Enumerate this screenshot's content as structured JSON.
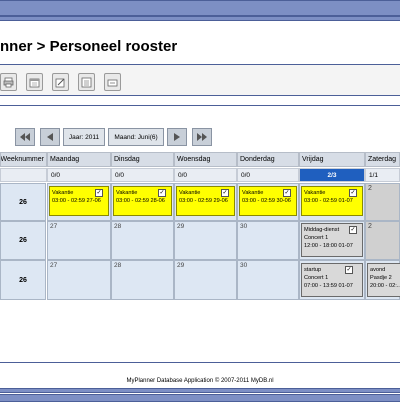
{
  "page": {
    "title": "nner > Personeel rooster"
  },
  "toolbar": {
    "icons": [
      "print-icon",
      "calendar-icon",
      "edit-icon",
      "list-icon",
      "export-icon"
    ]
  },
  "nav": {
    "year": "Jaar: 2011",
    "month": "Maand: Juni(6)"
  },
  "table": {
    "week_header": "Weeknummer",
    "days": [
      {
        "name": "Maandag",
        "count": "0/0"
      },
      {
        "name": "Dinsdag",
        "count": "0/0"
      },
      {
        "name": "Woensdag",
        "count": "0/0"
      },
      {
        "name": "Donderdag",
        "count": "0/0"
      },
      {
        "name": "Vrijdag",
        "count": "2/3"
      },
      {
        "name": "Zaterdag",
        "count": "1/1"
      }
    ],
    "rows": [
      {
        "week": "26",
        "cells": [
          {
            "events": [
              {
                "title": "Vakantie",
                "line1": "03:00 - 02:59 27-06",
                "color": "#ffff00"
              }
            ]
          },
          {
            "events": [
              {
                "title": "Vakantie",
                "line1": "03:00 - 02:59 28-06",
                "color": "#ffff00"
              }
            ]
          },
          {
            "events": [
              {
                "title": "Vakantie",
                "line1": "03:00 - 02:59 29-06",
                "color": "#ffff00"
              }
            ]
          },
          {
            "events": [
              {
                "title": "Vakantie",
                "line1": "03:00 - 02:59 30-06",
                "color": "#ffff00"
              }
            ]
          },
          {
            "events": [
              {
                "title": "Vakantie",
                "line1": "03:00 - 02:59 01-07",
                "color": "#ffff00"
              }
            ]
          },
          {
            "day": "2"
          }
        ]
      },
      {
        "week": "26",
        "cells": [
          {
            "day": "27"
          },
          {
            "day": "28"
          },
          {
            "day": "29"
          },
          {
            "day": "30"
          },
          {
            "events": [
              {
                "title": "Middag-dienst",
                "line1": "Concert 1",
                "line2": "12:00 - 18:00 01-07",
                "color": "#d9d9d9"
              }
            ]
          },
          {
            "day": "2"
          }
        ]
      },
      {
        "week": "26",
        "cells": [
          {
            "day": "27"
          },
          {
            "day": "28"
          },
          {
            "day": "29"
          },
          {
            "day": "30"
          },
          {
            "events": [
              {
                "title": "startup",
                "line1": "Concert 1",
                "line2": "07:00 - 13:59 01-07",
                "color": "#d9d9d9"
              }
            ]
          },
          {
            "events": [
              {
                "title": "avond",
                "line1": "Pasdje 2",
                "line2": "20:00 - 02:...",
                "color": "#d9d9d9"
              }
            ]
          }
        ]
      }
    ]
  },
  "footer": {
    "text": "MyPlanner Database Application © 2007-2011 MyDB.nl"
  },
  "colors": {
    "accent_band": "#7d8fc4",
    "today_header": "#1f5fbf",
    "vacation": "#ffff00",
    "shift": "#d9d9d9"
  }
}
